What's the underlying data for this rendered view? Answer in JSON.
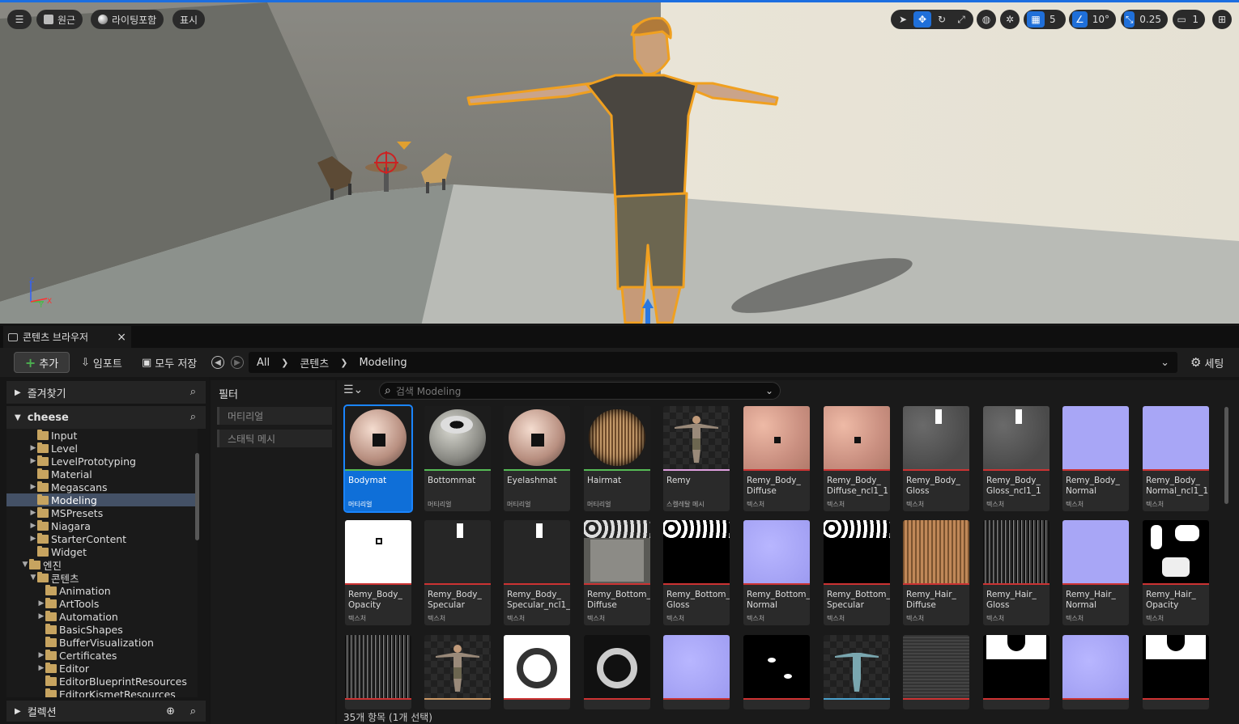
{
  "viewport": {
    "menu_icon": "hamburger-icon",
    "perspective_label": "원근",
    "lighting_label": "라이팅포함",
    "show_label": "표시",
    "grid_snap_value": "5",
    "rotation_snap_value": "10°",
    "scale_snap_value": "0.25",
    "camera_speed_value": "1",
    "axis": {
      "z": "Z",
      "y": "Y",
      "x": "X"
    }
  },
  "content_browser": {
    "tab_title": "콘텐츠 브라우저",
    "close_symbol": "×",
    "add_label": "추가",
    "import_label": "임포트",
    "save_all_label": "모두 저장",
    "breadcrumb": [
      "All",
      "콘텐츠",
      "Modeling"
    ],
    "settings_label": "세팅",
    "favorites_label": "즐겨찾기",
    "project_label": "cheese",
    "collections_label": "컬렉션",
    "filter_label": "필터",
    "filters": [
      "머티리얼",
      "스태틱 메시"
    ],
    "search_placeholder": "검색 Modeling",
    "status": "35개 항목 (1개 선택)"
  },
  "tree": [
    {
      "label": "Input",
      "indent": 1,
      "arrow": ""
    },
    {
      "label": "Level",
      "indent": 1,
      "arrow": "▶"
    },
    {
      "label": "LevelPrototyping",
      "indent": 1,
      "arrow": "▶"
    },
    {
      "label": "Material",
      "indent": 1,
      "arrow": ""
    },
    {
      "label": "Megascans",
      "indent": 1,
      "arrow": "▶"
    },
    {
      "label": "Modeling",
      "indent": 1,
      "arrow": "",
      "selected": true
    },
    {
      "label": "MSPresets",
      "indent": 1,
      "arrow": "▶"
    },
    {
      "label": "Niagara",
      "indent": 1,
      "arrow": "▶"
    },
    {
      "label": "StarterContent",
      "indent": 1,
      "arrow": "▶"
    },
    {
      "label": "Widget",
      "indent": 1,
      "arrow": ""
    },
    {
      "label": "엔진",
      "indent": 0,
      "arrow": "▼"
    },
    {
      "label": "콘텐츠",
      "indent": 1,
      "arrow": "▼"
    },
    {
      "label": "Animation",
      "indent": 2,
      "arrow": ""
    },
    {
      "label": "ArtTools",
      "indent": 2,
      "arrow": "▶"
    },
    {
      "label": "Automation",
      "indent": 2,
      "arrow": "▶"
    },
    {
      "label": "BasicShapes",
      "indent": 2,
      "arrow": ""
    },
    {
      "label": "BufferVisualization",
      "indent": 2,
      "arrow": ""
    },
    {
      "label": "Certificates",
      "indent": 2,
      "arrow": "▶"
    },
    {
      "label": "Editor",
      "indent": 2,
      "arrow": "▶"
    },
    {
      "label": "EditorBlueprintResources",
      "indent": 2,
      "arrow": ""
    },
    {
      "label": "EditorKismetResources",
      "indent": 2,
      "arrow": ""
    }
  ],
  "assets": [
    {
      "name": "Bodymat",
      "type": "머티리얼",
      "kind": "skin-sphere",
      "bar": "#55bb55",
      "selected": true
    },
    {
      "name": "Bottommat",
      "type": "머티리얼",
      "kind": "cloth-sphere",
      "bar": "#55bb55"
    },
    {
      "name": "Eyelashmat",
      "type": "머티리얼",
      "kind": "skin-sphere",
      "bar": "#55bb55"
    },
    {
      "name": "Hairmat",
      "type": "머티리얼",
      "kind": "hair-sphere",
      "bar": "#55bb55"
    },
    {
      "name": "Remy",
      "type": "스켈레탈 메시",
      "kind": "figure",
      "bar": "#e0a0e0"
    },
    {
      "name": "Remy_Body_\nDiffuse",
      "type": "텍스처",
      "kind": "skin-tex",
      "bar": "#cc3333"
    },
    {
      "name": "Remy_Body_\nDiffuse_ncl1_1",
      "type": "텍스처",
      "kind": "skin-tex",
      "bar": "#cc3333"
    },
    {
      "name": "Remy_Body_\nGloss",
      "type": "텍스처",
      "kind": "gray-tex",
      "bar": "#cc3333"
    },
    {
      "name": "Remy_Body_\nGloss_ncl1_1",
      "type": "텍스처",
      "kind": "gray-tex",
      "bar": "#cc3333"
    },
    {
      "name": "Remy_Body_\nNormal",
      "type": "텍스처",
      "kind": "normal-tex",
      "bar": "#cc3333"
    },
    {
      "name": "Remy_Body_\nNormal_ncl1_1",
      "type": "텍스처",
      "kind": "normal-tex",
      "bar": "#cc3333"
    },
    {
      "name": "Remy_Body_\nOpacity",
      "type": "텍스처",
      "kind": "white-tex",
      "bar": "#cc3333"
    },
    {
      "name": "Remy_Body_\nSpecular",
      "type": "텍스처",
      "kind": "dark-tex",
      "bar": "#cc3333"
    },
    {
      "name": "Remy_Body_\nSpecular_ncl1_",
      "type": "텍스처",
      "kind": "dark-tex",
      "bar": "#cc3333"
    },
    {
      "name": "Remy_Bottom_\nDiffuse",
      "type": "텍스처",
      "kind": "pants-tex",
      "bar": "#cc3333"
    },
    {
      "name": "Remy_Bottom_\nGloss",
      "type": "텍스처",
      "kind": "bw-tex",
      "bar": "#cc3333"
    },
    {
      "name": "Remy_Bottom_\nNormal",
      "type": "텍스처",
      "kind": "normal-tex2",
      "bar": "#cc3333"
    },
    {
      "name": "Remy_Bottom_\nSpecular",
      "type": "텍스처",
      "kind": "bw-tex",
      "bar": "#cc3333"
    },
    {
      "name": "Remy_Hair_\nDiffuse",
      "type": "텍스처",
      "kind": "hair-tex",
      "bar": "#cc3333"
    },
    {
      "name": "Remy_Hair_\nGloss",
      "type": "텍스처",
      "kind": "hairgloss-tex",
      "bar": "#cc3333"
    },
    {
      "name": "Remy_Hair_\nNormal",
      "type": "텍스처",
      "kind": "normal-tex",
      "bar": "#cc3333"
    },
    {
      "name": "Remy_Hair_\nOpacity",
      "type": "텍스처",
      "kind": "hairop-tex",
      "bar": "#cc3333"
    },
    {
      "name": "",
      "type": "",
      "kind": "hairgloss-tex",
      "bar": "#cc3333"
    },
    {
      "name": "",
      "type": "",
      "kind": "figure",
      "bar": "#cc9966"
    },
    {
      "name": "",
      "type": "",
      "kind": "swirl-tex",
      "bar": "#cc3333"
    },
    {
      "name": "",
      "type": "",
      "kind": "swirl-dark",
      "bar": "#cc3333"
    },
    {
      "name": "",
      "type": "",
      "kind": "normal-tex2",
      "bar": "#cc3333"
    },
    {
      "name": "",
      "type": "",
      "kind": "black-spots",
      "bar": "#cc3333"
    },
    {
      "name": "",
      "type": "",
      "kind": "figure2",
      "bar": "#4aa0cc"
    },
    {
      "name": "",
      "type": "",
      "kind": "shirt-tex",
      "bar": "#cc3333"
    },
    {
      "name": "",
      "type": "",
      "kind": "bwshirt-tex",
      "bar": "#cc3333"
    },
    {
      "name": "",
      "type": "",
      "kind": "normal-tex2",
      "bar": "#cc3333"
    },
    {
      "name": "",
      "type": "",
      "kind": "bwshirt-tex",
      "bar": "#cc3333"
    }
  ]
}
